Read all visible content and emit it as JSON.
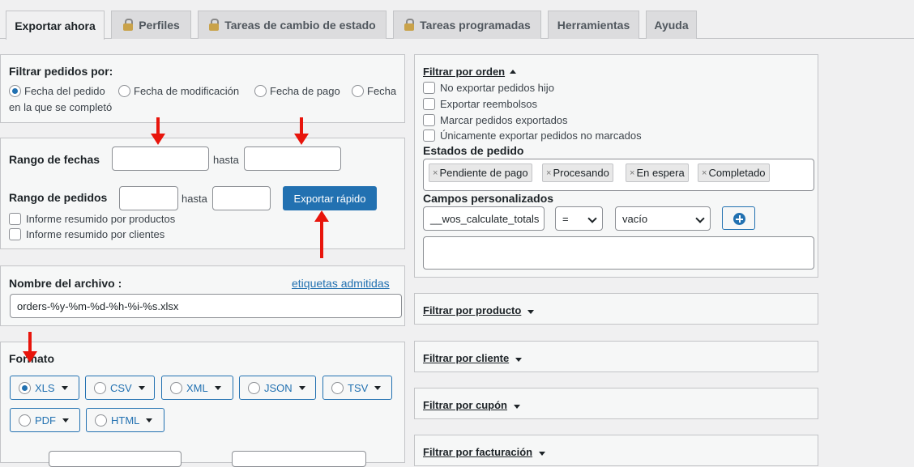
{
  "tabs": [
    {
      "label": "Exportar ahora",
      "locked": false
    },
    {
      "label": "Perfiles",
      "locked": true
    },
    {
      "label": "Tareas de cambio de estado",
      "locked": true
    },
    {
      "label": "Tareas programadas",
      "locked": true
    },
    {
      "label": "Herramientas",
      "locked": false
    },
    {
      "label": "Ayuda",
      "locked": false
    }
  ],
  "filter_by": {
    "title": "Filtrar pedidos por:",
    "options": [
      "Fecha del pedido",
      "Fecha de modificación",
      "Fecha de pago",
      "Fecha"
    ],
    "option_cont": "en la que se completó",
    "selected": "Fecha del pedido"
  },
  "range": {
    "dates_label": "Rango de fechas",
    "until": "hasta",
    "orders_label": "Rango de pedidos",
    "export_button": "Exportar rápido",
    "summary_products": "Informe resumido por productos",
    "summary_customers": "Informe resumido por clientes"
  },
  "filename": {
    "title": "Nombre del archivo :",
    "tags_link": "etiquetas admitidas",
    "value": "orders-%y-%m-%d-%h-%i-%s.xlsx"
  },
  "format": {
    "title": "Formato",
    "options": [
      "XLS",
      "CSV",
      "XML",
      "JSON",
      "TSV",
      "PDF",
      "HTML"
    ],
    "selected": "XLS"
  },
  "order_filter": {
    "title": "Filtrar por orden",
    "checks": [
      "No exportar pedidos hijo",
      "Exportar reembolsos",
      "Marcar pedidos exportados",
      "Únicamente exportar pedidos no marcados"
    ],
    "statuses_title": "Estados de pedido",
    "statuses": [
      "Pendiente de pago",
      "Procesando",
      "En espera",
      "Completado"
    ],
    "custom_title": "Campos personalizados",
    "custom_field": "__wos_calculate_totals",
    "operator": "=",
    "value": "vacío"
  },
  "sections": [
    "Filtrar por producto",
    "Filtrar por cliente",
    "Filtrar por cupón",
    "Filtrar por facturación"
  ],
  "colors": {
    "accent": "#2271b1",
    "arrow": "#e8150c"
  }
}
